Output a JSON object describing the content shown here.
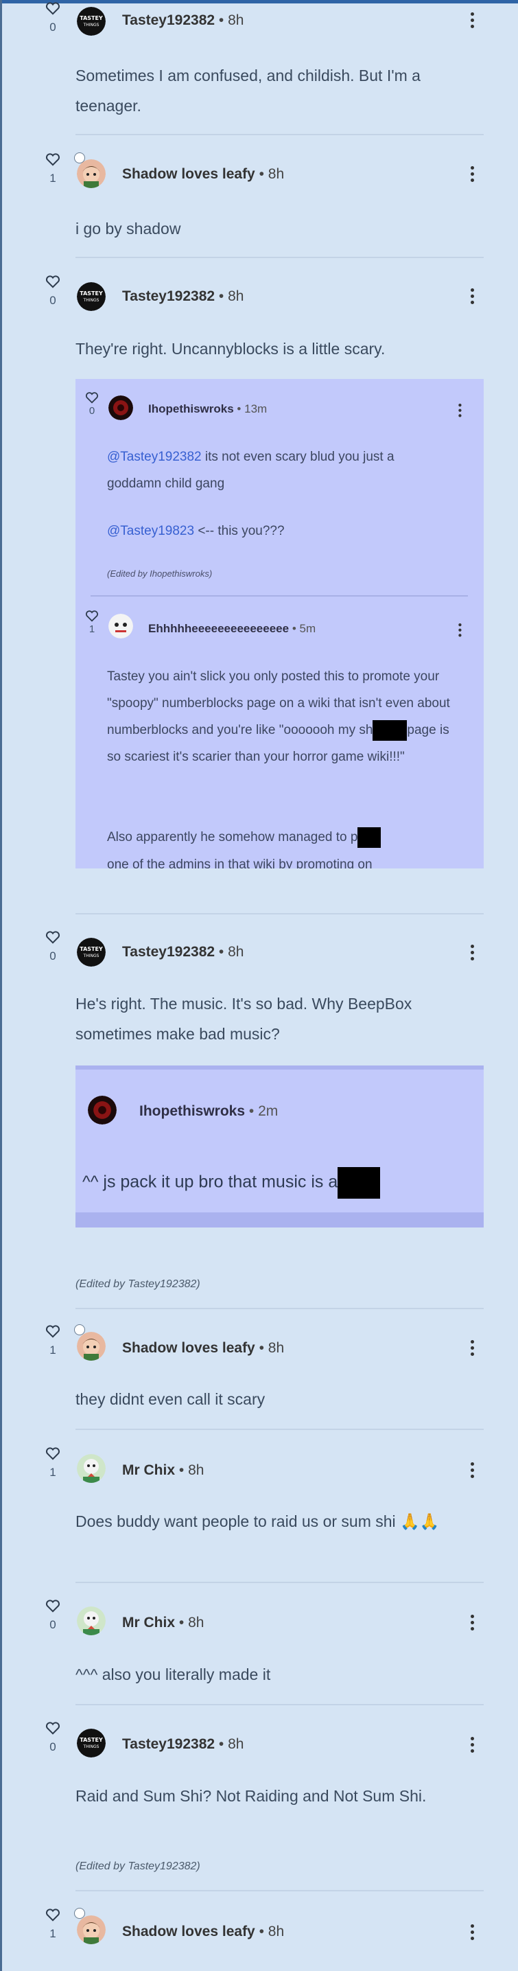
{
  "comments": [
    {
      "author": "Tastey192382",
      "time": "8h",
      "likes": "0",
      "text": "Sometimes I am confused, and childish. But I'm a teenager."
    },
    {
      "author": "Shadow loves leafy",
      "time": "8h",
      "likes": "1",
      "text": "i go by shadow"
    },
    {
      "author": "Tastey192382",
      "time": "8h",
      "likes": "0",
      "text": "They're right. Uncannyblocks is a little scary.",
      "replies": [
        {
          "author": "Ihopethiswroks",
          "time": "13m",
          "likes": "0",
          "mention": "@Tastey192382",
          "text": "its not even scary blud you just a goddamn child gang",
          "mention2": "@Tastey19823",
          "text2": "<-- this you???",
          "edited": "(Edited by Ihopethiswroks)"
        },
        {
          "author": "Ehhhhheeeeeeeeeeeeeee",
          "time": "5m",
          "likes": "1",
          "text_a": "Tastey you ain't slick you only posted this to promote your \"spoopy\" numberblocks page on a wiki that isn't even about numberblocks and you're like \"ooooooh my sh",
          "text_b": "page is so scariest it's scarier than your horror game wiki!!!\"",
          "text_c": "Also apparently he somehow managed to p",
          "text_d": "one of the admins in that wiki by promoting on"
        }
      ]
    },
    {
      "author": "Tastey192382",
      "time": "8h",
      "likes": "0",
      "text": "He's right. The music. It's so bad. Why BeepBox sometimes make bad music?",
      "quote": {
        "author": "Ihopethiswroks",
        "time": "2m",
        "text": "^^ js pack it up bro that music is a"
      },
      "edited": "(Edited by Tastey192382)"
    },
    {
      "author": "Shadow loves leafy",
      "time": "8h",
      "likes": "1",
      "text": "they didnt even call it scary"
    },
    {
      "author": "Mr Chix",
      "time": "8h",
      "likes": "1",
      "text": "Does buddy want people to raid us or sum shi 🙏🙏"
    },
    {
      "author": "Mr Chix",
      "time": "8h",
      "likes": "0",
      "text": "^^^ also you literally made it"
    },
    {
      "author": "Tastey192382",
      "time": "8h",
      "likes": "0",
      "text": "Raid and Sum Shi? Not Raiding and Not Sum Shi.",
      "edited": "(Edited by Tastey192382)"
    },
    {
      "author": "Shadow loves leafy",
      "time": "8h",
      "likes": "1",
      "text": ""
    }
  ],
  "ui": {
    "dot": "•",
    "accent": "#2f64a6",
    "reply_bg": "#c2c9fb"
  }
}
